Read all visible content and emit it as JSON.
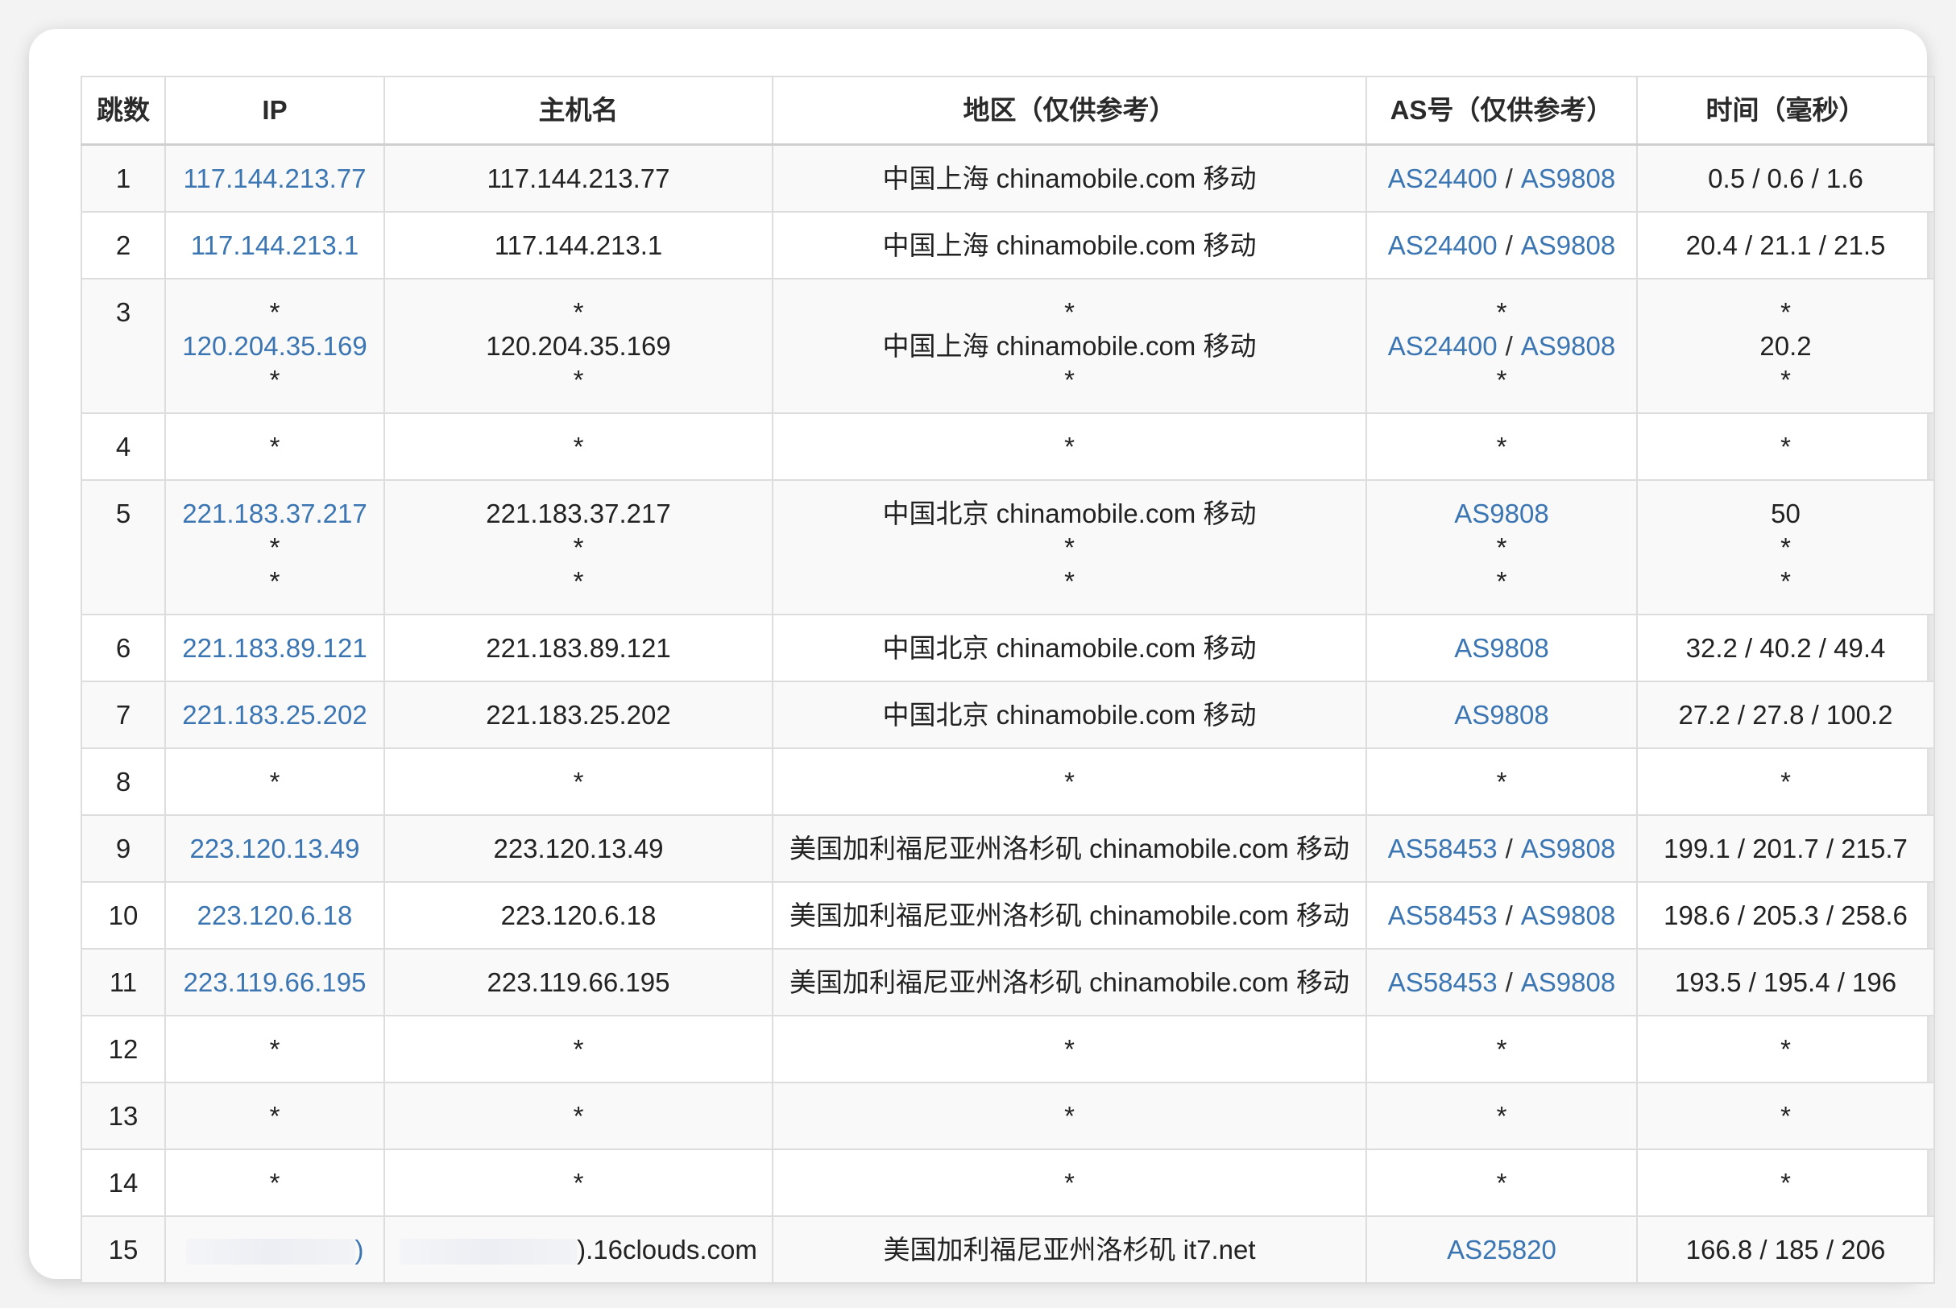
{
  "headers": {
    "hop": "跳数",
    "ip": "IP",
    "host": "主机名",
    "region": "地区（仅供参考）",
    "as": "AS号（仅供参考）",
    "time": "时间（毫秒）"
  },
  "colors": {
    "link": "#3b76b3",
    "border": "#dddddd",
    "zebra": "#f9f9f9"
  },
  "rows": [
    {
      "hop": "1",
      "ip": [
        "117.144.213.77"
      ],
      "host": [
        "117.144.213.77"
      ],
      "region": [
        "中国上海 chinamobile.com 移动"
      ],
      "as": [
        [
          "AS24400",
          "AS9808"
        ]
      ],
      "time": [
        "0.5 / 0.6 / 1.6"
      ]
    },
    {
      "hop": "2",
      "ip": [
        "117.144.213.1"
      ],
      "host": [
        "117.144.213.1"
      ],
      "region": [
        "中国上海 chinamobile.com 移动"
      ],
      "as": [
        [
          "AS24400",
          "AS9808"
        ]
      ],
      "time": [
        "20.4 / 21.1 / 21.5"
      ]
    },
    {
      "hop": "3",
      "ip": [
        "*",
        "120.204.35.169",
        "*"
      ],
      "host": [
        "*",
        "120.204.35.169",
        "*"
      ],
      "region": [
        "*",
        "中国上海 chinamobile.com 移动",
        "*"
      ],
      "as": [
        [
          "*"
        ],
        [
          "AS24400",
          "AS9808"
        ],
        [
          "*"
        ]
      ],
      "time": [
        "*",
        "20.2",
        "*"
      ]
    },
    {
      "hop": "4",
      "ip": [
        "*"
      ],
      "host": [
        "*"
      ],
      "region": [
        "*"
      ],
      "as": [
        [
          "*"
        ]
      ],
      "time": [
        "*"
      ]
    },
    {
      "hop": "5",
      "ip": [
        "221.183.37.217",
        "*",
        "*"
      ],
      "host": [
        "221.183.37.217",
        "*",
        "*"
      ],
      "region": [
        "中国北京 chinamobile.com 移动",
        "*",
        "*"
      ],
      "as": [
        [
          "AS9808"
        ],
        [
          "*"
        ],
        [
          "*"
        ]
      ],
      "time": [
        "50",
        "*",
        "*"
      ]
    },
    {
      "hop": "6",
      "ip": [
        "221.183.89.121"
      ],
      "host": [
        "221.183.89.121"
      ],
      "region": [
        "中国北京 chinamobile.com 移动"
      ],
      "as": [
        [
          "AS9808"
        ]
      ],
      "time": [
        "32.2 / 40.2 / 49.4"
      ]
    },
    {
      "hop": "7",
      "ip": [
        "221.183.25.202"
      ],
      "host": [
        "221.183.25.202"
      ],
      "region": [
        "中国北京 chinamobile.com 移动"
      ],
      "as": [
        [
          "AS9808"
        ]
      ],
      "time": [
        "27.2 / 27.8 / 100.2"
      ]
    },
    {
      "hop": "8",
      "ip": [
        "*"
      ],
      "host": [
        "*"
      ],
      "region": [
        "*"
      ],
      "as": [
        [
          "*"
        ]
      ],
      "time": [
        "*"
      ]
    },
    {
      "hop": "9",
      "ip": [
        "223.120.13.49"
      ],
      "host": [
        "223.120.13.49"
      ],
      "region": [
        "美国加利福尼亚州洛杉矶 chinamobile.com 移动"
      ],
      "as": [
        [
          "AS58453",
          "AS9808"
        ]
      ],
      "time": [
        "199.1 / 201.7 / 215.7"
      ]
    },
    {
      "hop": "10",
      "ip": [
        "223.120.6.18"
      ],
      "host": [
        "223.120.6.18"
      ],
      "region": [
        "美国加利福尼亚州洛杉矶 chinamobile.com 移动"
      ],
      "as": [
        [
          "AS58453",
          "AS9808"
        ]
      ],
      "time": [
        "198.6 / 205.3 / 258.6"
      ]
    },
    {
      "hop": "11",
      "ip": [
        "223.119.66.195"
      ],
      "host": [
        "223.119.66.195"
      ],
      "region": [
        "美国加利福尼亚州洛杉矶 chinamobile.com 移动"
      ],
      "as": [
        [
          "AS58453",
          "AS9808"
        ]
      ],
      "time": [
        "193.5 / 195.4 / 196"
      ]
    },
    {
      "hop": "12",
      "ip": [
        "*"
      ],
      "host": [
        "*"
      ],
      "region": [
        "*"
      ],
      "as": [
        [
          "*"
        ]
      ],
      "time": [
        "*"
      ]
    },
    {
      "hop": "13",
      "ip": [
        "*"
      ],
      "host": [
        "*"
      ],
      "region": [
        "*"
      ],
      "as": [
        [
          "*"
        ]
      ],
      "time": [
        "*"
      ]
    },
    {
      "hop": "14",
      "ip": [
        "*"
      ],
      "host": [
        "*"
      ],
      "region": [
        "*"
      ],
      "as": [
        [
          "*"
        ]
      ],
      "time": [
        "*"
      ]
    },
    {
      "hop": "15",
      "ip": [
        ")"
      ],
      "host": [
        ").16clouds.com"
      ],
      "region": [
        "美国加利福尼亚州洛杉矶 it7.net"
      ],
      "as": [
        [
          "AS25820"
        ]
      ],
      "time": [
        "166.8 / 185 / 206"
      ],
      "redacted": true
    }
  ]
}
